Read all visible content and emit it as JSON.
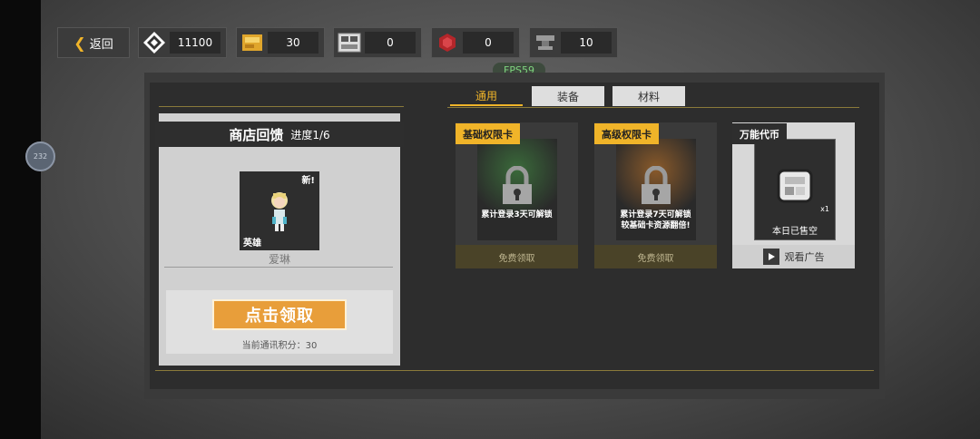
{
  "topbar": {
    "back_label": "返回",
    "resources": [
      {
        "icon": "diamond-icon",
        "value": "11100"
      },
      {
        "icon": "gold-bar-icon",
        "value": "30"
      },
      {
        "icon": "circuit-chip-icon",
        "value": "0"
      },
      {
        "icon": "red-gem-icon",
        "value": "0"
      },
      {
        "icon": "anvil-icon",
        "value": "10"
      }
    ]
  },
  "fps_label": "FPS59",
  "floating_button_label": "232",
  "tabs": [
    {
      "label": "通用",
      "active": true
    },
    {
      "label": "装备",
      "active": false
    },
    {
      "label": "材料",
      "active": false
    }
  ],
  "feedback_panel": {
    "title": "商店回馈",
    "progress": "进度1/6",
    "reward": {
      "badge": "新!",
      "type": "英雄",
      "name": "爱琳"
    },
    "claim_button": "点击领取",
    "points_text": "当前通讯积分：30"
  },
  "shop_cards": [
    {
      "title": "基础权限卡",
      "lock_text": [
        "累计登录3天可解锁"
      ],
      "action": "免费领取"
    },
    {
      "title": "高级权限卡",
      "lock_text": [
        "累计登录7天可解锁",
        "较基础卡资源翻倍!"
      ],
      "action": "免费领取"
    },
    {
      "title": "万能代币",
      "count": "x1",
      "status": "本日已售空",
      "action": "观看广告"
    }
  ],
  "colors": {
    "accent": "#f0b429",
    "panel_dark": "#2d2d2d",
    "fps_green": "#7fd37f"
  }
}
